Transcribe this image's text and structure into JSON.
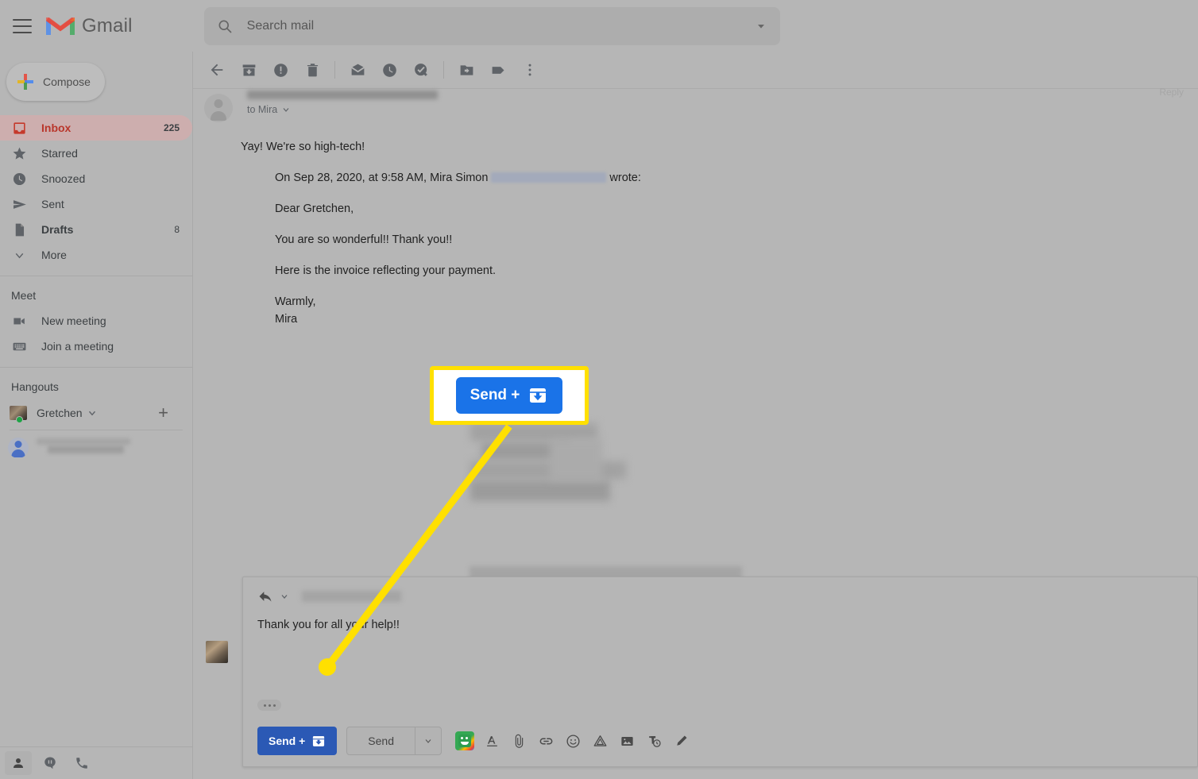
{
  "app": {
    "name": "Gmail",
    "accent_red": "#b9362b",
    "accent_blue": "#1a73e8",
    "callout_yellow": "#ffe000"
  },
  "topbar": {
    "menu_icon": "hamburger-icon",
    "logo_icon": "gmail-logo-icon",
    "logo_label": "Gmail"
  },
  "search": {
    "icon": "search-icon",
    "placeholder": "Search mail",
    "value": "",
    "options_icon": "chevron-down-icon"
  },
  "sidebar": {
    "compose": {
      "label": "Compose",
      "icon": "plus-icon"
    },
    "items": [
      {
        "label": "Inbox",
        "count": "225",
        "icon": "inbox-icon",
        "active": true,
        "bold": true
      },
      {
        "label": "Starred",
        "count": "",
        "icon": "star-icon",
        "active": false,
        "bold": false
      },
      {
        "label": "Snoozed",
        "count": "",
        "icon": "clock-icon",
        "active": false,
        "bold": false
      },
      {
        "label": "Sent",
        "count": "",
        "icon": "send-icon",
        "active": false,
        "bold": false
      },
      {
        "label": "Drafts",
        "count": "8",
        "icon": "document-icon",
        "active": false,
        "bold": true
      },
      {
        "label": "More",
        "count": "",
        "icon": "chevron-down-icon",
        "active": false,
        "bold": false
      }
    ],
    "meet": {
      "title": "Meet",
      "items": [
        {
          "label": "New meeting",
          "icon": "video-camera-icon"
        },
        {
          "label": "Join a meeting",
          "icon": "keyboard-icon"
        }
      ]
    },
    "hangouts": {
      "title": "Hangouts",
      "user": {
        "name": "Gretchen",
        "status_icon": "presence-online-dot",
        "caret_icon": "chevron-down-icon"
      },
      "add_icon": "plus-icon",
      "contact_name_redacted": ""
    },
    "bottom_bar": [
      {
        "icon": "contacts-person-icon",
        "selected": true
      },
      {
        "icon": "hangouts-chat-icon",
        "selected": false
      },
      {
        "icon": "phone-icon",
        "selected": false
      }
    ]
  },
  "mail_toolbar": {
    "buttons": [
      {
        "icon": "back-arrow-icon"
      },
      {
        "icon": "archive-icon"
      },
      {
        "icon": "report-spam-icon"
      },
      {
        "icon": "delete-trash-icon"
      },
      {
        "icon": "mark-unread-icon"
      },
      {
        "icon": "snooze-clock-icon"
      },
      {
        "icon": "add-to-tasks-icon"
      },
      {
        "icon": "move-to-folder-icon"
      },
      {
        "icon": "labels-tag-icon"
      },
      {
        "icon": "more-vertical-icon"
      }
    ],
    "reply_corner_label": "Reply"
  },
  "message": {
    "sender_redacted": "",
    "to_line": "to Mira",
    "to_caret_icon": "chevron-down-icon",
    "body": "Yay! We're so high-tech!",
    "quoted": {
      "intro_prefix": "On Sep 28, 2020, at 9:58 AM, Mira Simon",
      "intro_email_redacted": "",
      "intro_suffix": "wrote:",
      "lines": [
        "Dear Gretchen,",
        "You are so wonderful!! Thank you!!",
        "Here is the invoice reflecting your payment.",
        "Warmly,",
        "Mira"
      ]
    }
  },
  "compose": {
    "reply_icon": "reply-arrow-icon",
    "reply_caret_icon": "chevron-down-icon",
    "recipient_redacted": "",
    "body": "Thank you for all your help!!",
    "show_trimmed_icon": "ellipsis-icon",
    "send_plus_label": "Send +",
    "send_plus_icon": "archive-icon",
    "send_label": "Send",
    "send_caret_icon": "chevron-down-icon",
    "toolbar": [
      {
        "icon": "bitmoji-icon"
      },
      {
        "icon": "formatting-options-icon"
      },
      {
        "icon": "attach-file-icon"
      },
      {
        "icon": "insert-link-icon"
      },
      {
        "icon": "insert-emoji-icon"
      },
      {
        "icon": "insert-drive-file-icon"
      },
      {
        "icon": "insert-photo-icon"
      },
      {
        "icon": "confidential-mode-icon"
      },
      {
        "icon": "insert-signature-pen-icon"
      }
    ]
  },
  "callout": {
    "button_label": "Send +",
    "button_icon": "archive-icon",
    "pointer_icon": "callout-pointer-dot"
  }
}
